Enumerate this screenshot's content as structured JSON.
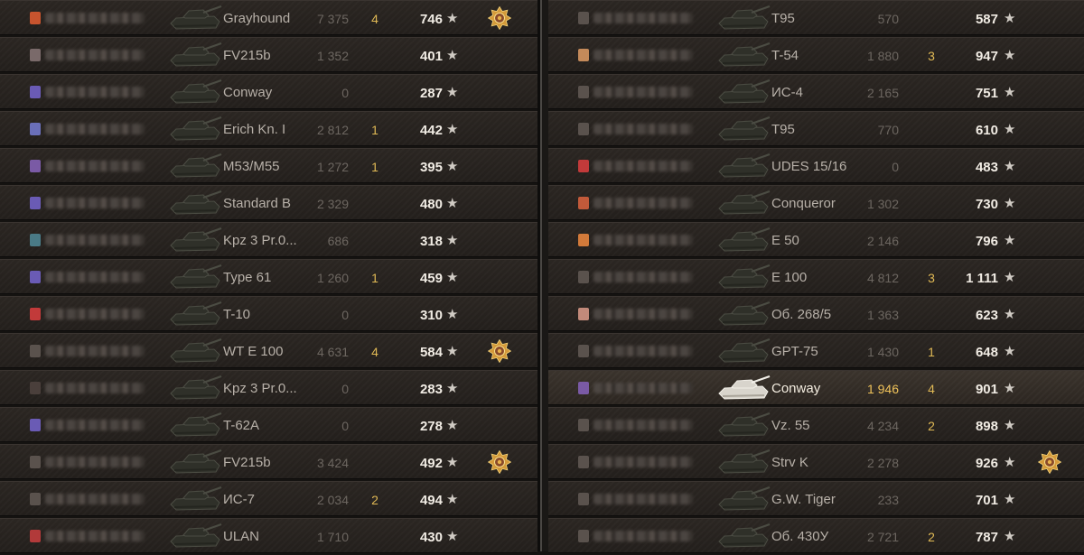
{
  "colors": {
    "tank_text": "#b7b0a8",
    "player_highlight_text": "#efc25a",
    "kills": "#e0b955",
    "xp": "#f1ece4"
  },
  "teams": [
    {
      "name": "left",
      "rows": [
        {
          "flag": "#c7542e",
          "tank": "Grayhound",
          "damage": "7 375",
          "kills": "4",
          "xp": "746",
          "medal": true
        },
        {
          "flag": "#7a6a6a",
          "tank": "FV215b",
          "damage": "1 352",
          "kills": "",
          "xp": "401",
          "medal": false
        },
        {
          "flag": "#6a5bb5",
          "tank": "Conway",
          "damage": "0",
          "kills": "",
          "xp": "287",
          "medal": false
        },
        {
          "flag": "#6a6fb8",
          "tank": "Erich Kn. I",
          "damage": "2 812",
          "kills": "1",
          "xp": "442",
          "medal": false
        },
        {
          "flag": "#7a5aa5",
          "tank": "M53/M55",
          "damage": "1 272",
          "kills": "1",
          "xp": "395",
          "medal": false
        },
        {
          "flag": "#6a5bb5",
          "tank": "Standard B",
          "damage": "2 329",
          "kills": "",
          "xp": "480",
          "medal": false
        },
        {
          "flag": "#4a7a86",
          "tank": "Kpz 3 Pr.0...",
          "damage": "686",
          "kills": "",
          "xp": "318",
          "medal": false
        },
        {
          "flag": "#6a5bb5",
          "tank": "Type 61",
          "damage": "1 260",
          "kills": "1",
          "xp": "459",
          "medal": false
        },
        {
          "flag": "#c23a3a",
          "tank": "T-10",
          "damage": "0",
          "kills": "",
          "xp": "310",
          "medal": false
        },
        {
          "flag": "#5a524d",
          "tank": "WT E 100",
          "damage": "4 631",
          "kills": "4",
          "xp": "584",
          "medal": true
        },
        {
          "flag": "#4a3f3b",
          "tank": "Kpz 3 Pr.0...",
          "damage": "0",
          "kills": "",
          "xp": "283",
          "medal": false
        },
        {
          "flag": "#6a5bb5",
          "tank": "T-62A",
          "damage": "0",
          "kills": "",
          "xp": "278",
          "medal": false
        },
        {
          "flag": "#5a524d",
          "tank": "FV215b",
          "damage": "3 424",
          "kills": "",
          "xp": "492",
          "medal": true
        },
        {
          "flag": "#5a524d",
          "tank": "ИС-7",
          "damage": "2 034",
          "kills": "2",
          "xp": "494",
          "medal": false
        },
        {
          "flag": "#b23a3a",
          "tank": "ULAN",
          "damage": "1 710",
          "kills": "",
          "xp": "430",
          "medal": false
        }
      ]
    },
    {
      "name": "right",
      "rows": [
        {
          "flag": "#5a524d",
          "tank": "T95",
          "damage": "570",
          "kills": "",
          "xp": "587",
          "medal": false
        },
        {
          "flag": "#c48a5a",
          "tank": "T-54",
          "damage": "1 880",
          "kills": "3",
          "xp": "947",
          "medal": false
        },
        {
          "flag": "#5a524d",
          "tank": "ИС-4",
          "damage": "2 165",
          "kills": "",
          "xp": "751",
          "medal": false
        },
        {
          "flag": "#5a524d",
          "tank": "T95",
          "damage": "770",
          "kills": "",
          "xp": "610",
          "medal": false
        },
        {
          "flag": "#c23a3a",
          "tank": "UDES 15/16",
          "damage": "0",
          "kills": "",
          "xp": "483",
          "medal": false
        },
        {
          "flag": "#c25a3a",
          "tank": "Conqueror",
          "damage": "1 302",
          "kills": "",
          "xp": "730",
          "medal": false
        },
        {
          "flag": "#d27a3a",
          "tank": "E 50",
          "damage": "2 146",
          "kills": "",
          "xp": "796",
          "medal": false
        },
        {
          "flag": "#5a524d",
          "tank": "E 100",
          "damage": "4 812",
          "kills": "3",
          "xp": "1 111",
          "medal": false
        },
        {
          "flag": "#c28a7a",
          "tank": "Об. 268/5",
          "damage": "1 363",
          "kills": "",
          "xp": "623",
          "medal": false
        },
        {
          "flag": "#5a524d",
          "tank": "GPT-75",
          "damage": "1 430",
          "kills": "1",
          "xp": "648",
          "medal": false
        },
        {
          "flag": "#7a5aa5",
          "tank": "Conway",
          "damage": "1 946",
          "kills": "4",
          "xp": "901",
          "medal": false,
          "player": true
        },
        {
          "flag": "#5a524d",
          "tank": "Vz. 55",
          "damage": "4 234",
          "kills": "2",
          "xp": "898",
          "medal": false
        },
        {
          "flag": "#5a524d",
          "tank": "Strv K",
          "damage": "2 278",
          "kills": "",
          "xp": "926",
          "medal": true
        },
        {
          "flag": "#5a524d",
          "tank": "G.W. Tiger",
          "damage": "233",
          "kills": "",
          "xp": "701",
          "medal": false
        },
        {
          "flag": "#5a524d",
          "tank": "Об. 430У",
          "damage": "2 721",
          "kills": "2",
          "xp": "787",
          "medal": false
        }
      ]
    }
  ],
  "icons": {
    "star": "★",
    "tank": "tank-silhouette-icon",
    "medal": "medal-icon"
  }
}
